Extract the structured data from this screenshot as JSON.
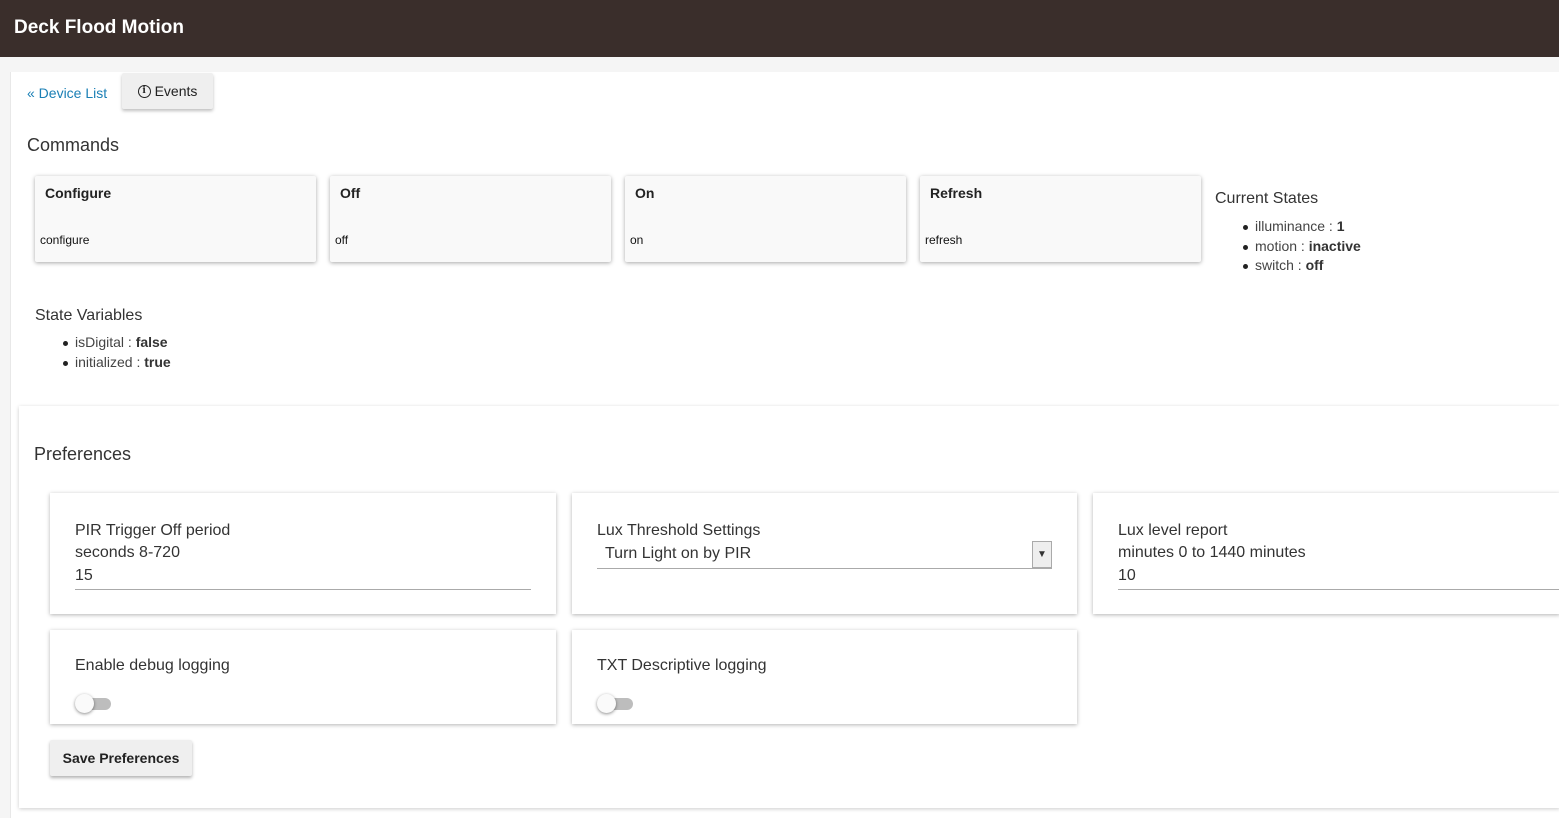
{
  "header": {
    "title": "Deck Flood Motion"
  },
  "nav": {
    "device_list_link": "« Device List",
    "events_button": "Events",
    "events_icon": "info-circle-icon"
  },
  "commands": {
    "heading": "Commands",
    "items": [
      {
        "name": "Configure",
        "method": "configure"
      },
      {
        "name": "Off",
        "method": "off"
      },
      {
        "name": "On",
        "method": "on"
      },
      {
        "name": "Refresh",
        "method": "refresh"
      }
    ]
  },
  "current_states": {
    "heading": "Current States",
    "items": [
      {
        "key": "illuminance",
        "sep": " : ",
        "value": "1"
      },
      {
        "key": "motion",
        "sep": " : ",
        "value": "inactive"
      },
      {
        "key": "switch",
        "sep": " : ",
        "value": "off"
      }
    ]
  },
  "state_variables": {
    "heading": "State Variables",
    "items": [
      {
        "key": "isDigital",
        "sep": " : ",
        "value": "false"
      },
      {
        "key": "initialized",
        "sep": " : ",
        "value": "true"
      }
    ]
  },
  "preferences": {
    "heading": "Preferences",
    "pir_trigger": {
      "label_line1": "PIR Trigger Off period",
      "label_line2": "seconds 8-720",
      "value": "15"
    },
    "lux_threshold": {
      "label": "Lux Threshold Settings",
      "selected": "Turn Light on by PIR"
    },
    "lux_report": {
      "label_line1": "Lux level report",
      "label_line2": "minutes 0 to 1440 minutes",
      "value": "10"
    },
    "debug_logging": {
      "label": "Enable debug logging",
      "enabled": false
    },
    "txt_logging": {
      "label": "TXT Descriptive logging",
      "enabled": false
    },
    "save_button": "Save Preferences"
  }
}
